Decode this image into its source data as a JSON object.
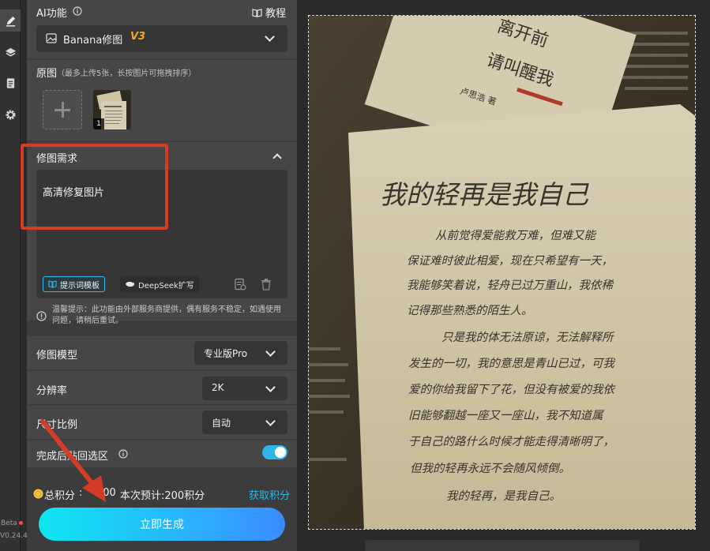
{
  "rail": {
    "beta": "Beta",
    "version": "V0.24.4"
  },
  "header": {
    "title": "AI功能",
    "tutorial": "教程"
  },
  "model_select": {
    "name": "Banana修图",
    "version": "V3"
  },
  "source": {
    "title": "原图",
    "hint": "（最多上传5张，长按图片可拖拽排序）",
    "thumb_count": "1"
  },
  "edit": {
    "title": "修图需求",
    "prompt": "高清修复图片",
    "template_button": "提示词模板",
    "deepseek_button": "DeepSeek扩写"
  },
  "notice": "温馨提示：此功能由外部服务商提供，偶有服务不稳定，如遇使用问题，请稍后重试。",
  "settings": {
    "model_label": "修图模型",
    "model_value": "专业版Pro",
    "resolution_label": "分辨率",
    "resolution_value": "2K",
    "ratio_label": "尺寸比例",
    "ratio_value": "自动",
    "paste_label": "完成后贴回选区",
    "paste_enabled": true
  },
  "points": {
    "total_label": "总积分",
    "total_value": "300",
    "estimate": "本次预计:200积分",
    "get_link": "获取积分"
  },
  "generate_button": "立即生成",
  "photo": {
    "book_title_1": "离开前",
    "book_title_2": "请叫醒我",
    "author": "卢思浩 著",
    "heading": "我的轻再是我自己",
    "lines": [
      "从前觉得爱能救万难，但难又能",
      "保证难时彼此相爱，现在只希望有一天，",
      "我能够笑着说，轻舟已过万重山，我依稀",
      "记得那些熟悉的陌生人。",
      "只是我的体无法原谅，无法解释所",
      "发生的一切，我的意思是青山已过，可我",
      "爱的你给我留下了花，但没有被爱的我依",
      "旧能够翻越一座又一座山，我不知道属",
      "于自己的路什么时候才能走得清晰明了，",
      "但我的轻再永远不会随风倾倒。",
      "我的轻再，是我自己。"
    ]
  },
  "colors": {
    "accent": "#2fb6e9",
    "version_badge": "#f5a623",
    "link": "#2fb6e9",
    "annotation": "#d43c27"
  }
}
